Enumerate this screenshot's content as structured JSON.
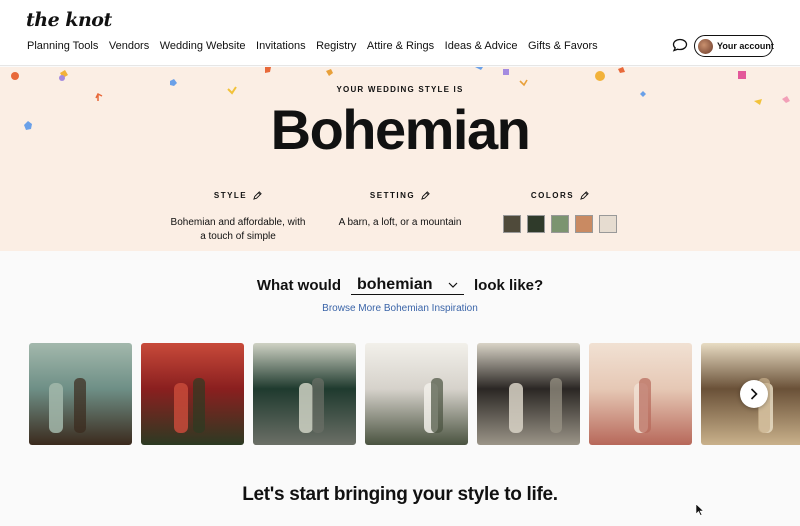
{
  "header": {
    "logo": "the knot",
    "nav": [
      "Planning Tools",
      "Vendors",
      "Wedding Website",
      "Invitations",
      "Registry",
      "Attire & Rings",
      "Ideas & Advice",
      "Gifts & Favors"
    ],
    "account_label": "Your account"
  },
  "hero": {
    "eyebrow": "YOUR WEDDING STYLE IS",
    "title": "Bohemian",
    "style": {
      "label": "STYLE",
      "text_line1": "Bohemian and affordable, with",
      "text_line2": "a touch of simple"
    },
    "setting": {
      "label": "SETTING",
      "text": "A barn, a loft, or a mountain"
    },
    "colors": {
      "label": "COLORS",
      "swatches": [
        "#4f4a3a",
        "#2f3a2a",
        "#7c9470",
        "#c98a62",
        "#e6dcd0"
      ]
    }
  },
  "explore": {
    "prefix": "What would",
    "selected": "bohemian",
    "suffix": "look like?",
    "browse_link": "Browse More Bohemian Inspiration"
  },
  "gallery": {
    "photos": [
      {
        "name": "photo-1",
        "colors": [
          "#6e8f86",
          "#3b2a1d",
          "#a3b8ac"
        ]
      },
      {
        "name": "photo-2",
        "colors": [
          "#8a1f1f",
          "#2c3a22",
          "#c84a3a"
        ]
      },
      {
        "name": "photo-3",
        "colors": [
          "#1f3a2e",
          "#6b6f66",
          "#cfd2c4"
        ]
      },
      {
        "name": "photo-4",
        "colors": [
          "#d6d2cb",
          "#4a5340",
          "#f2f0ea"
        ]
      },
      {
        "name": "photo-5",
        "colors": [
          "#2b2724",
          "#9b9588",
          "#d9d4c7"
        ]
      },
      {
        "name": "photo-6",
        "colors": [
          "#e6c8b5",
          "#b7685a",
          "#f1e1d3"
        ]
      },
      {
        "name": "photo-7",
        "colors": [
          "#6a5138",
          "#c9b18b",
          "#e8dcc3"
        ]
      }
    ]
  },
  "bottom_title": "Let's start bringing your style to life."
}
